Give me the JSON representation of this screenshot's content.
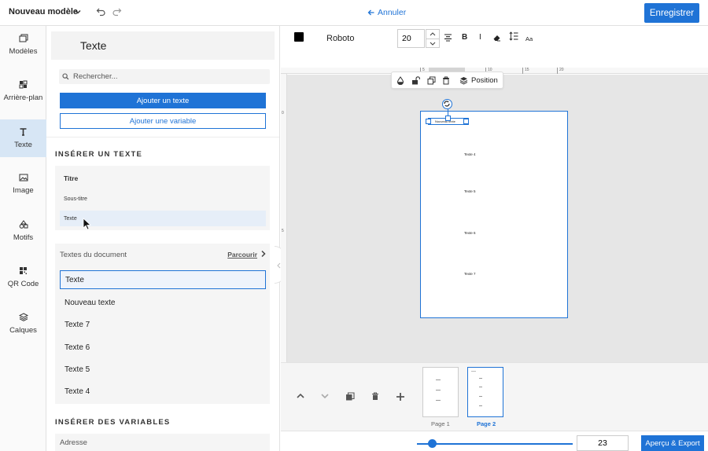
{
  "app": {
    "title": "Nouveau modèle",
    "cancel_label": "Annuler",
    "save_label": "Enregistrer"
  },
  "rail": {
    "items": [
      {
        "label": "Modèles",
        "icon": "templates-icon"
      },
      {
        "label": "Arrière-plan",
        "icon": "background-icon"
      },
      {
        "label": "Texte",
        "icon": "text-icon",
        "active": true
      },
      {
        "label": "Image",
        "icon": "image-icon"
      },
      {
        "label": "Motifs",
        "icon": "shapes-icon"
      },
      {
        "label": "QR Code",
        "icon": "qr-code-icon"
      },
      {
        "label": "Calques",
        "icon": "layers-icon"
      }
    ]
  },
  "panel": {
    "title": "Texte",
    "search_placeholder": "Rechercher...",
    "add_text_label": "Ajouter un texte",
    "add_variable_label": "Ajouter une variable",
    "insert_text_title": "INSÉRER UN TEXTE",
    "insert_items": [
      "Titre",
      "Sous-titre",
      "Texte"
    ],
    "doc_texts_label": "Textes du document",
    "browse_label": "Parcourir",
    "doc_texts": [
      "Texte",
      "Nouveau texte",
      "Texte 7",
      "Texte 6",
      "Texte 5",
      "Texte 4"
    ],
    "insert_vars_title": "INSÉRER DES VARIABLES",
    "variables": [
      "Adresse"
    ]
  },
  "format": {
    "color": "#000000",
    "font": "Roboto",
    "size": "20",
    "bold": "B",
    "italic": "I",
    "case": "Aa"
  },
  "ruler": {
    "ticks": [
      "5",
      "10",
      "15",
      "20"
    ],
    "left_ticks": [
      "0",
      "5"
    ]
  },
  "canvas": {
    "position_label": "Position",
    "page_texts": [
      "Texte 4",
      "Texte 5",
      "Texte 6",
      "Texte 7"
    ],
    "selected_text": "Nouveau texte"
  },
  "pages": [
    {
      "label": "Page 1"
    },
    {
      "label": "Page 2",
      "active": true
    }
  ],
  "footer": {
    "zoom": "23",
    "export_label": "Aperçu & Export"
  },
  "colors": {
    "accent": "#1f73d6"
  }
}
